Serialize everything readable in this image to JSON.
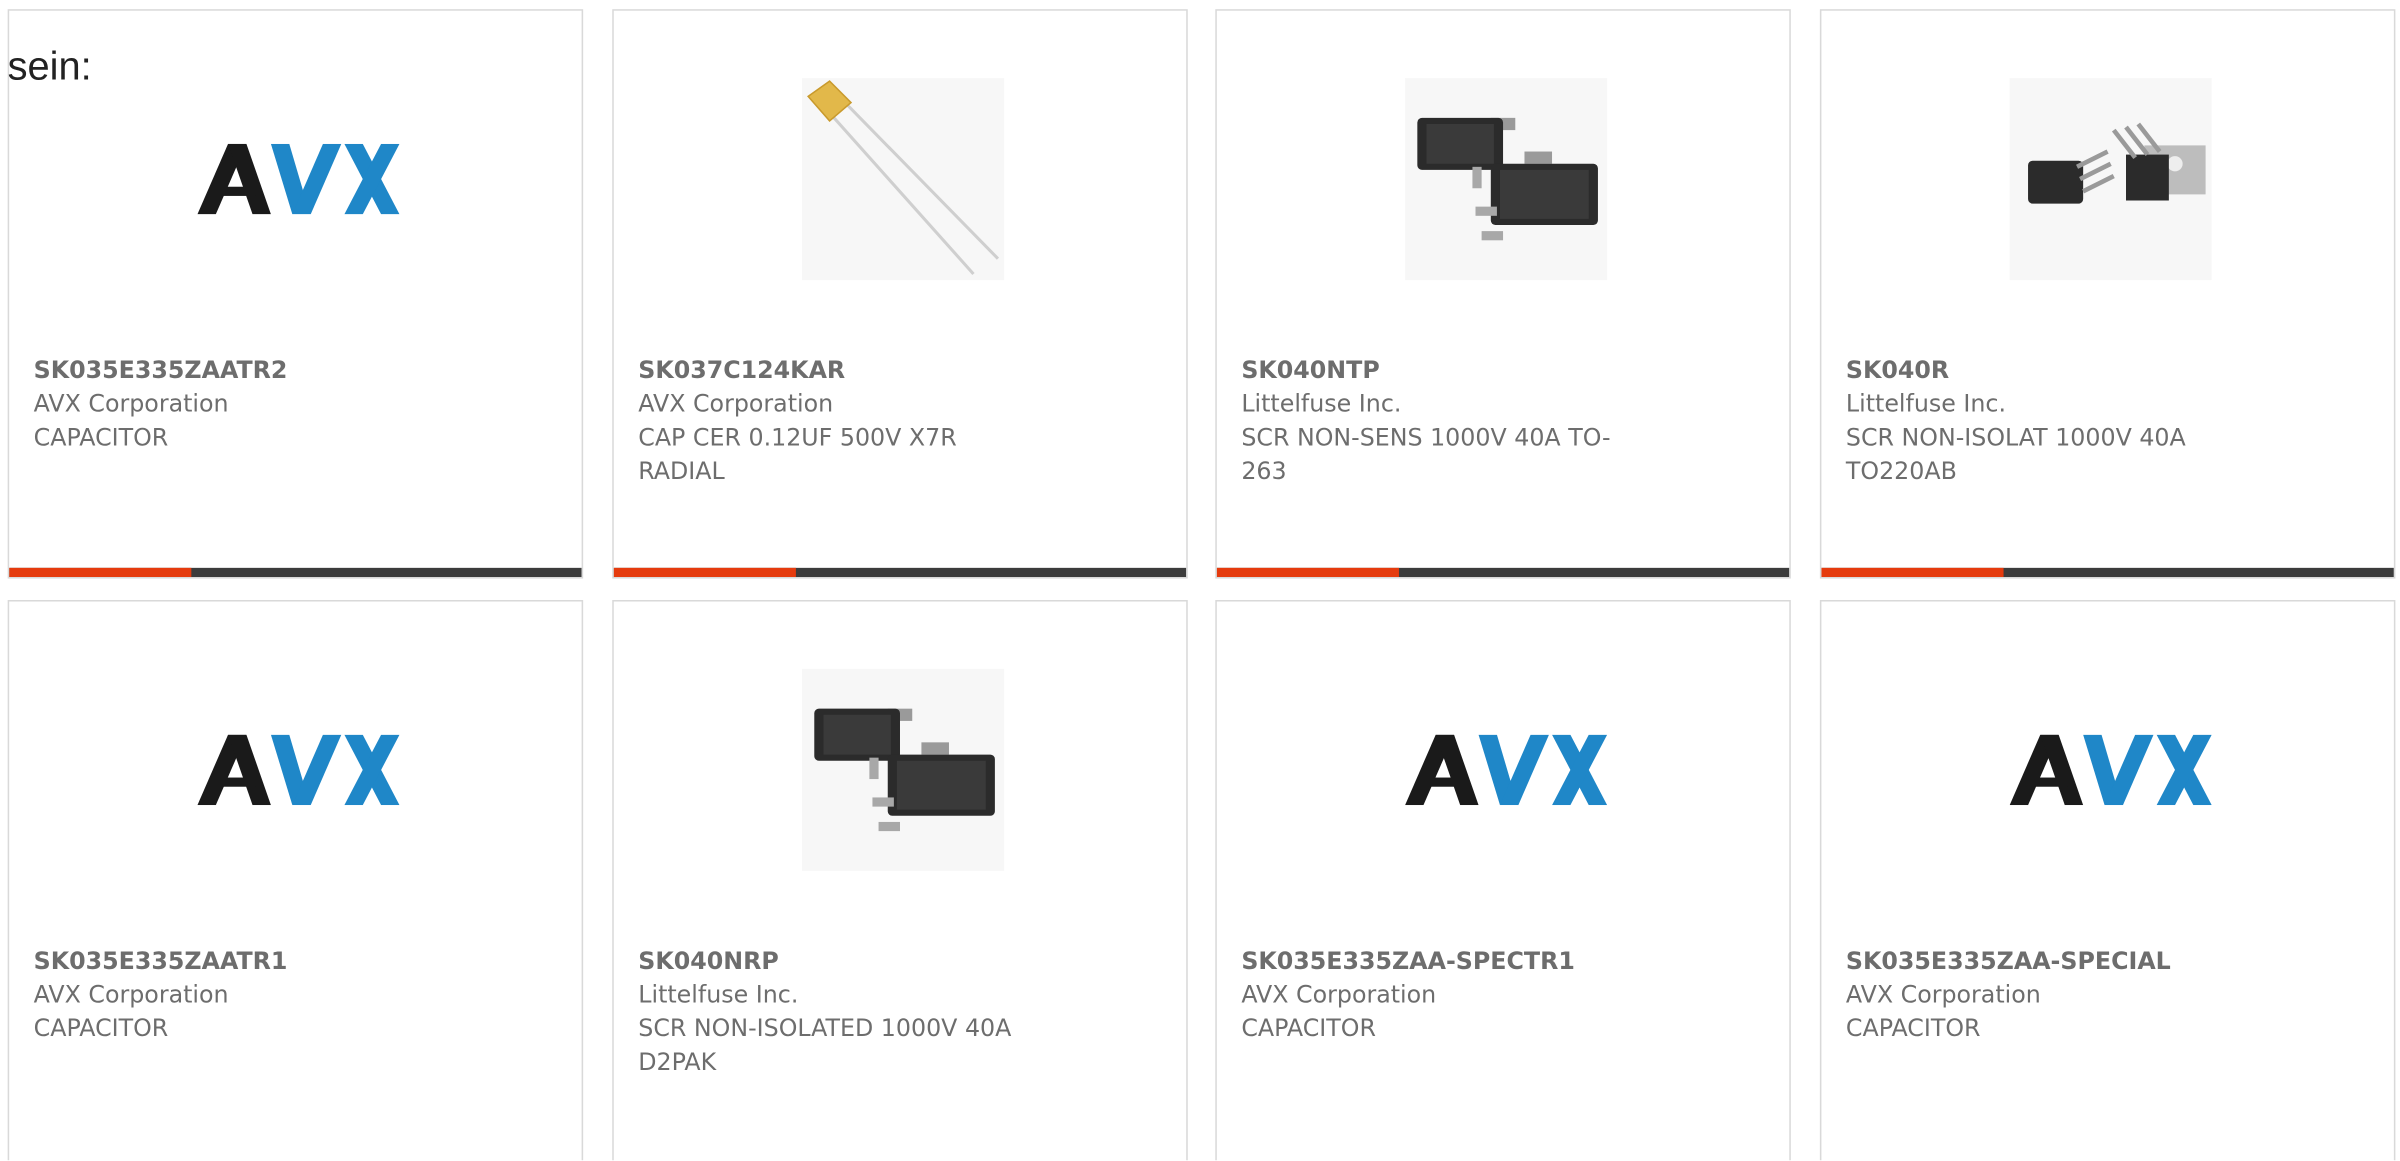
{
  "intro_text": "sein:",
  "colors": {
    "accent": "#e53b0e",
    "bar": "#3c3c3c",
    "text": "#6d6d6d",
    "avx_dark": "#1a1a1a",
    "avx_blue": "#1f87c8"
  },
  "products": [
    {
      "part_no": "SK035E335ZAATR2",
      "manufacturer": "AVX Corporation",
      "description": "CAPACITOR",
      "image": "avx-logo"
    },
    {
      "part_no": "SK037C124KAR",
      "manufacturer": "AVX Corporation",
      "description": "CAP CER 0.12UF 500V X7R RADIAL",
      "image": "radial-capacitor"
    },
    {
      "part_no": "SK040NTP",
      "manufacturer": "Littelfuse Inc.",
      "description": "SCR NON-SENS 1000V 40A TO-263",
      "image": "d2pak-package"
    },
    {
      "part_no": "SK040R",
      "manufacturer": "Littelfuse Inc.",
      "description": "SCR NON-ISOLAT 1000V 40A TO220AB",
      "image": "to220-package"
    },
    {
      "part_no": "SK035E335ZAATR1",
      "manufacturer": "AVX Corporation",
      "description": "CAPACITOR",
      "image": "avx-logo"
    },
    {
      "part_no": "SK040NRP",
      "manufacturer": "Littelfuse Inc.",
      "description": "SCR NON-ISOLATED 1000V 40A D2PAK",
      "image": "d2pak-package"
    },
    {
      "part_no": "SK035E335ZAA-SPECTR1",
      "manufacturer": "AVX Corporation",
      "description": "CAPACITOR",
      "image": "avx-logo"
    },
    {
      "part_no": "SK035E335ZAA-SPECIAL",
      "manufacturer": "AVX Corporation",
      "description": "CAPACITOR",
      "image": "avx-logo"
    }
  ]
}
